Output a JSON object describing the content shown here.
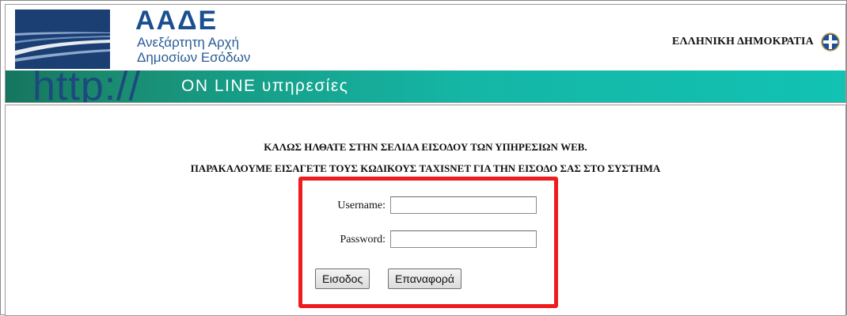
{
  "header": {
    "logo_title": "ΑΑΔΕ",
    "logo_sub1": "Ανεξάρτητη Αρχή",
    "logo_sub2": "Δημοσίων Εσόδων",
    "republic": "ΕΛΛΗΝΙΚΗ ΔΗΜΟΚΡΑΤΙΑ",
    "banner_http": "http://",
    "banner_label": "ON LINE υπηρεσίες",
    "brand_color": "#1b4f8f",
    "banner_color": "#15b6a6"
  },
  "main": {
    "welcome_line1": "ΚΑΛΩΣ ΗΛΘΑΤΕ ΣΤΗΝ ΣΕΛΙΔΑ ΕΙΣΟΔΟΥ ΤΩΝ ΥΠΗΡΕΣΙΩΝ WEB.",
    "welcome_line2": "ΠΑΡΑΚΑΛΟΥΜΕ ΕΙΣΑΓΕΤΕ ΤΟΥΣ ΚΩΔΙΚΟΥΣ TAXISNET ΓΙΑ ΤΗΝ ΕΙΣΟΔΟ ΣΑΣ ΣΤΟ ΣΥΣΤΗΜΑ"
  },
  "login": {
    "username_label": "Username:",
    "username_value": "",
    "password_label": "Password:",
    "password_value": "",
    "login_button": "Εισοδος",
    "reset_button": "Επαναφορά",
    "highlight_color": "#ee1c1c"
  }
}
